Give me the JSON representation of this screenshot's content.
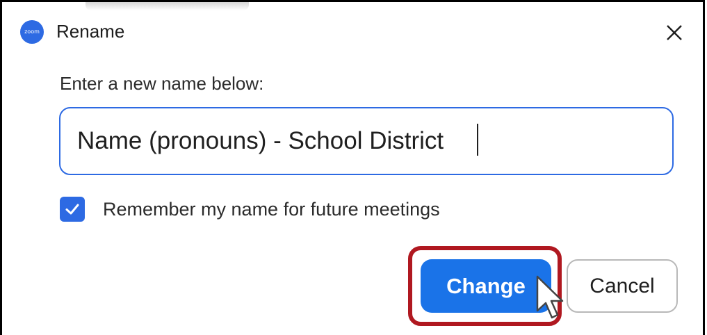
{
  "dialog": {
    "title": "Rename",
    "app_logo_text": "zoom",
    "brand_color": "#2d6ae3",
    "prompt": "Enter a new name below:",
    "name_input": {
      "value": "Name (pronouns) - School District"
    },
    "remember": {
      "checked": true,
      "label": "Remember my name for future meetings"
    },
    "buttons": {
      "change_label": "Change",
      "cancel_label": "Cancel"
    },
    "highlight_color": "#b01820",
    "icons": {
      "close": "close-icon",
      "checkmark": "checkmark-icon",
      "cursor": "mouse-pointer-icon"
    }
  }
}
